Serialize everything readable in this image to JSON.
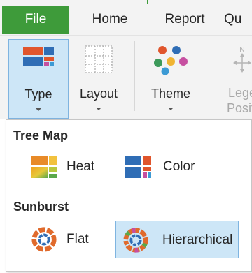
{
  "tabs": [
    {
      "label": "File"
    },
    {
      "label": "Home"
    },
    {
      "label": "Report"
    },
    {
      "label": "Qu"
    }
  ],
  "ribbon": {
    "type_label": "Type",
    "layout_label": "Layout",
    "theme_label": "Theme",
    "legend_label": "Legend Position",
    "legend_line1": "Lege",
    "legend_line2": "Positi"
  },
  "dropdown": {
    "treemap_title": "Tree Map",
    "treemap_options": [
      {
        "label": "Heat",
        "icon": "treemap-heat-icon"
      },
      {
        "label": "Color",
        "icon": "treemap-color-icon"
      }
    ],
    "sunburst_title": "Sunburst",
    "sunburst_options": [
      {
        "label": "Flat",
        "icon": "sunburst-flat-icon"
      },
      {
        "label": "Hierarchical",
        "icon": "sunburst-hierarchical-icon",
        "selected": true
      }
    ]
  },
  "colors": {
    "file_tab": "#3e9b3a",
    "selection_fill": "#cde6f7",
    "selection_border": "#7fb4e0"
  }
}
